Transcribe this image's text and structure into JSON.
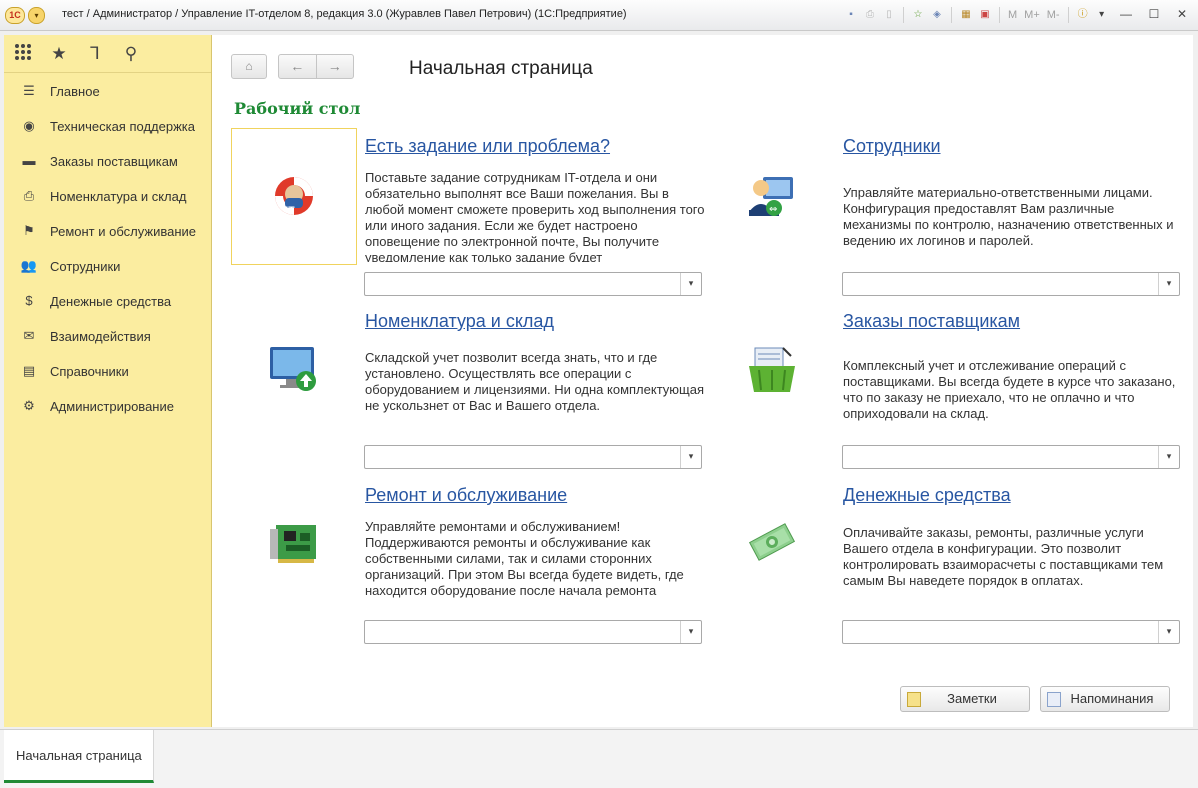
{
  "window": {
    "title": "тест / Администратор / Управление IT-отделом 8, редакция 3.0 (Журавлев Павел Петрович)  (1С:Предприятие)",
    "logo_text": "1C",
    "toolbar": {
      "m": "M",
      "m_plus": "M+",
      "m_minus": "M-"
    }
  },
  "sidebar": {
    "top_icons": [
      "grid-icon",
      "star-icon",
      "history-icon",
      "search-icon"
    ],
    "items": [
      {
        "label": "Главное",
        "icon": "menu-lines-icon"
      },
      {
        "label": "Техническая поддержка",
        "icon": "lifebuoy-icon"
      },
      {
        "label": "Заказы поставщикам",
        "icon": "truck-icon"
      },
      {
        "label": "Номенклатура и склад",
        "icon": "printer-icon"
      },
      {
        "label": "Ремонт и обслуживание",
        "icon": "flag-icon"
      },
      {
        "label": "Сотрудники",
        "icon": "people-icon"
      },
      {
        "label": "Денежные средства",
        "icon": "money-bag-icon"
      },
      {
        "label": "Взаимодействия",
        "icon": "envelope-icon"
      },
      {
        "label": "Справочники",
        "icon": "books-icon"
      },
      {
        "label": "Администрирование",
        "icon": "gear-icon"
      }
    ]
  },
  "main": {
    "page_title": "Начальная страница",
    "section_title": "Рабочий стол",
    "cards": [
      {
        "title": "Есть задание или проблема?",
        "icon": "it-lifebuoy-icon",
        "desc": "Поставьте задание сотрудникам IT-отдела и они обязательно выполнят все Ваши пожелания. Вы в любой момент сможете проверить ход выполнения того или иного задания. Если же будет настроено оповещение по электронной почте, Вы получите уведомление как только задание будет",
        "select_value": ""
      },
      {
        "title": "Сотрудники",
        "icon": "user-computer-icon",
        "desc": "Управляйте материально-ответственными лицами. Конфигурация предоставлят Вам различные механизмы по контролю, назначению ответственных и ведению их логинов и паролей.",
        "select_value": ""
      },
      {
        "title": "Номенклатура и склад",
        "icon": "monitor-upload-icon",
        "desc": "Складской учет позволит всегда знать, что и где установлено. Осуществлять все операции с оборудованием и лицензиями. Ни одна комплектующая не ускользнет от Вас и Вашего отдела.",
        "select_value": ""
      },
      {
        "title": "Заказы поставщикам",
        "icon": "shopping-basket-icon",
        "desc": "Комплексный учет и отслеживание операций с поставщиками. Вы всегда будете в курсе что заказано, что по заказу не приехало, что не оплачно и что оприходовали на склад.",
        "select_value": ""
      },
      {
        "title": "Ремонт и обслуживание",
        "icon": "circuit-board-icon",
        "desc": "Управляйте ремонтами и обслуживанием! Поддерживаются ремонты и обслуживание как собственными силами, так и силами сторонних организаций. При этом Вы всегда будете видеть, где находится оборудование после начала ремонта",
        "select_value": ""
      },
      {
        "title": "Денежные средства",
        "icon": "banknotes-icon",
        "desc": "Оплачивайте заказы, ремонты, различные услуги Вашего отдела в конфигурации. Это позволит контролировать взаиморасчеты с поставщиками тем самым Вы наведете порядок в оплатах.",
        "select_value": ""
      }
    ],
    "buttons": {
      "notes": "Заметки",
      "reminders": "Напоминания"
    }
  },
  "tabs": [
    {
      "label": "Начальная страница"
    }
  ]
}
